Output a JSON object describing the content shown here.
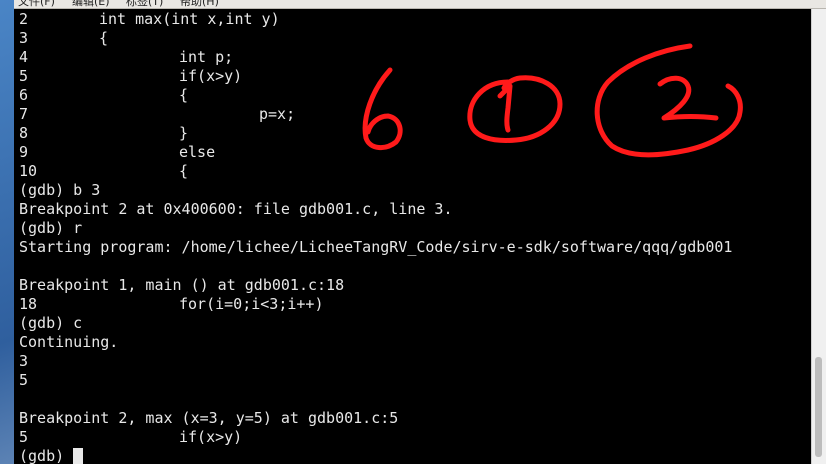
{
  "menubar": {
    "items": [
      "文件(F)",
      "编辑(E)",
      "标签(T)",
      "帮助(H)"
    ]
  },
  "terminal": {
    "lines": [
      {
        "n": "2",
        "indent": 1,
        "code": "int max(int x,int y)"
      },
      {
        "n": "3",
        "indent": 1,
        "code": "{"
      },
      {
        "n": "4",
        "indent": 2,
        "code": "int p;"
      },
      {
        "n": "5",
        "indent": 2,
        "code": "if(x>y)"
      },
      {
        "n": "6",
        "indent": 2,
        "code": "{"
      },
      {
        "n": "7",
        "indent": 3,
        "code": "p=x;"
      },
      {
        "n": "8",
        "indent": 2,
        "code": "}"
      },
      {
        "n": "9",
        "indent": 2,
        "code": "else"
      },
      {
        "n": "10",
        "indent": 2,
        "code": "{"
      },
      {
        "text": "(gdb) b 3"
      },
      {
        "text": "Breakpoint 2 at 0x400600: file gdb001.c, line 3."
      },
      {
        "text": "(gdb) r"
      },
      {
        "text": "Starting program: /home/lichee/LicheeTangRV_Code/sirv-e-sdk/software/qqq/gdb001"
      },
      {
        "text": ""
      },
      {
        "text": "Breakpoint 1, main () at gdb001.c:18"
      },
      {
        "n": "18",
        "indent": 2,
        "code": "for(i=0;i<3;i++)"
      },
      {
        "text": "(gdb) c"
      },
      {
        "text": "Continuing."
      },
      {
        "text": "3"
      },
      {
        "text": "5"
      },
      {
        "text": ""
      },
      {
        "text": "Breakpoint 2, max (x=3, y=5) at gdb001.c:5"
      },
      {
        "n": "5",
        "indent": 2,
        "code": "if(x>y)"
      }
    ],
    "prompt": "(gdb) "
  },
  "colors": {
    "background": "#000000",
    "foreground": "#e8e8e8",
    "annotation": "#ff1a1a"
  }
}
